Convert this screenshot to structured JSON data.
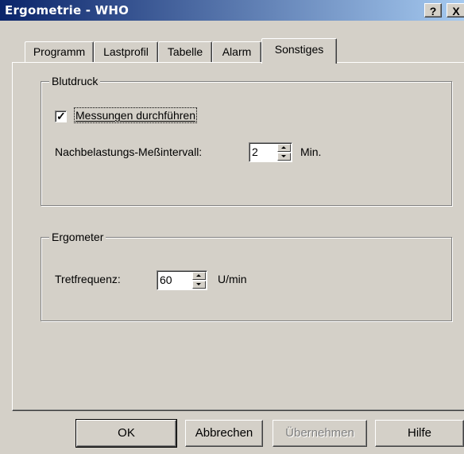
{
  "window": {
    "title": "Ergometrie - WHO",
    "help_button": "?",
    "close_button": "X"
  },
  "tabs": [
    {
      "label": "Programm",
      "active": false
    },
    {
      "label": "Lastprofil",
      "active": false
    },
    {
      "label": "Tabelle",
      "active": false
    },
    {
      "label": "Alarm",
      "active": false
    },
    {
      "label": "Sonstiges",
      "active": true
    }
  ],
  "blutdruck": {
    "group_label": "Blutdruck",
    "checkbox_label": "Messungen durchführen",
    "checked": true,
    "interval_label": "Nachbelastungs-Meßintervall:",
    "interval_value": "2",
    "interval_unit": "Min."
  },
  "ergometer": {
    "group_label": "Ergometer",
    "tret_label": "Tretfrequenz:",
    "tret_value": "60",
    "tret_unit": "U/min"
  },
  "buttons": {
    "ok": "OK",
    "cancel": "Abbrechen",
    "apply": "Übernehmen",
    "help": "Hilfe"
  },
  "colors": {
    "titlebar_start": "#0a246a",
    "titlebar_end": "#a6caf0",
    "face": "#d4d0c8"
  }
}
